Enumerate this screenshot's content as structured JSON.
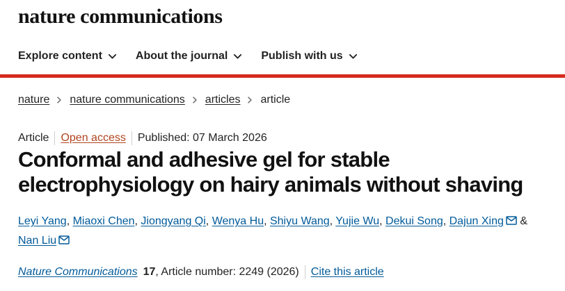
{
  "site": {
    "logo": "nature communications"
  },
  "nav": {
    "items": [
      {
        "label": "Explore content"
      },
      {
        "label": "About the journal"
      },
      {
        "label": "Publish with us"
      }
    ]
  },
  "colors": {
    "brand_bar": "#d52b1e",
    "link_blue": "#005a9a",
    "open_access_orange": "#b1451f"
  },
  "breadcrumb": {
    "items": [
      {
        "label": "nature"
      },
      {
        "label": "nature communications"
      },
      {
        "label": "articles"
      },
      {
        "label": "article"
      }
    ]
  },
  "article": {
    "type": "Article",
    "access": "Open access",
    "published": "Published: 07 March 2026",
    "title": "Conformal and adhesive gel for stable electrophysiology on hairy animals without shaving",
    "authors": [
      {
        "name": "Leyi Yang",
        "separator": ", "
      },
      {
        "name": "Miaoxi Chen",
        "separator": ", "
      },
      {
        "name": "Jiongyang Qi",
        "separator": ", "
      },
      {
        "name": "Wenya Hu",
        "separator": ", "
      },
      {
        "name": "Shiyu Wang",
        "separator": ", "
      },
      {
        "name": "Yujie Wu",
        "separator": ", "
      },
      {
        "name": "Dekui Song",
        "separator": ", "
      },
      {
        "name": "Dajun Xing",
        "separator": " & "
      },
      {
        "name": "Nan Liu",
        "separator": ""
      }
    ],
    "citation": {
      "journal": "Nature Communications",
      "volume": "17",
      "article_number": ", Article number: 2249 (2026)",
      "cite_label": "Cite this article"
    }
  },
  "icons": {
    "chevron": "chevron-down-icon",
    "breadcrumb_separator": "chevron-right-icon",
    "email": "mail-icon"
  }
}
